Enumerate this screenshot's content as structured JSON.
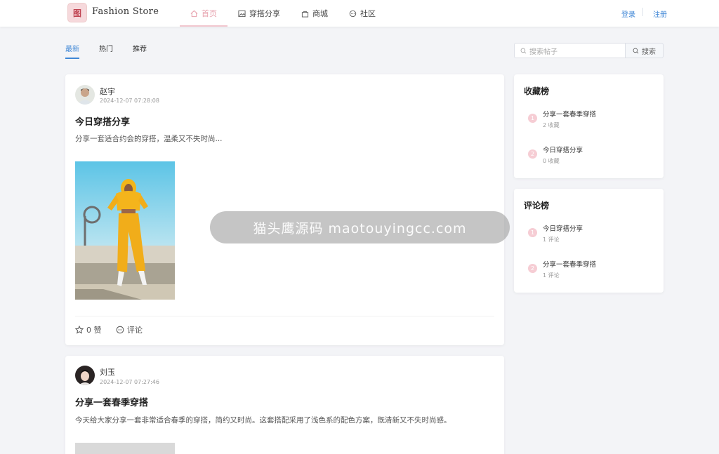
{
  "app": {
    "logo_text": "图",
    "brand": "Fashion Store"
  },
  "nav": [
    {
      "label": "首页",
      "icon": "home-icon"
    },
    {
      "label": "穿搭分享",
      "icon": "image-icon"
    },
    {
      "label": "商城",
      "icon": "bag-icon"
    },
    {
      "label": "社区",
      "icon": "chat-icon"
    }
  ],
  "auth": {
    "login": "登录",
    "register": "注册"
  },
  "tabs": [
    "最新",
    "热门",
    "推荐"
  ],
  "search": {
    "placeholder": "搜索帖子",
    "button": "搜索"
  },
  "posts": [
    {
      "author": "赵宇",
      "time": "2024-12-07 07:28:08",
      "title": "今日穿搭分享",
      "excerpt": "分享一套适合约会的穿搭，温柔又不失时尚...",
      "likes": "0 赞",
      "comment": "评论"
    },
    {
      "author": "刘玉",
      "time": "2024-12-07 07:27:46",
      "title": "分享一套春季穿搭",
      "excerpt": "今天给大家分享一套非常适合春季的穿搭，简约又时尚。这套搭配采用了浅色系的配色方案，既清新又不失时尚感。"
    }
  ],
  "favorites": {
    "title": "收藏榜",
    "items": [
      {
        "rank": "1",
        "title": "分享一套春季穿搭",
        "count": "2 收藏"
      },
      {
        "rank": "2",
        "title": "今日穿搭分享",
        "count": "0 收藏"
      }
    ]
  },
  "comments_rank": {
    "title": "评论榜",
    "items": [
      {
        "rank": "1",
        "title": "今日穿搭分享",
        "count": "1 评论"
      },
      {
        "rank": "2",
        "title": "分享一套春季穿搭",
        "count": "1 评论"
      }
    ]
  },
  "overlay": "猫头鹰源码 maotouyingcc.com",
  "colors": {
    "accent": "#3e86d6",
    "active_nav": "#e7a1ad",
    "rank_badge": "#f6cdd4"
  }
}
